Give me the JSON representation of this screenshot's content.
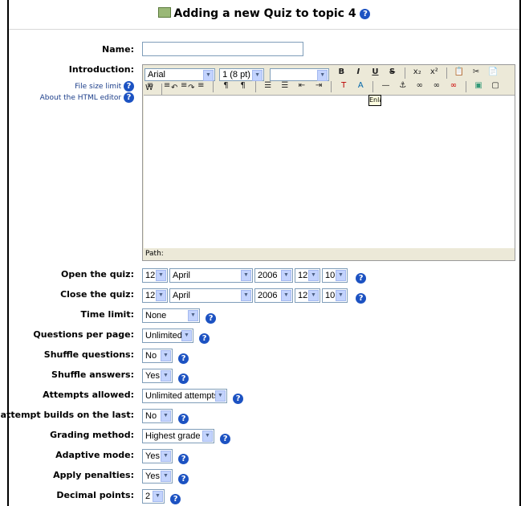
{
  "header": {
    "title": "Adding a new Quiz to topic 4",
    "help": "?"
  },
  "name": {
    "label": "Name:",
    "value": ""
  },
  "intro": {
    "label": "Introduction:",
    "file_size_link": "File size limit",
    "html_editor_link": "About the HTML editor",
    "font_family": "Arial",
    "font_size": "1 (8 pt)",
    "font_format": "",
    "toolbar_row1": [
      "B",
      "I",
      "U",
      "S",
      "x₂",
      "x²",
      "📋",
      "✂",
      "📄",
      "W",
      "↶",
      "↷"
    ],
    "toolbar_row2": [
      "≡",
      "≡",
      "≡",
      "≡",
      "¶",
      "¶",
      "☰",
      "☰",
      "⇤",
      "⇥",
      "T",
      "A",
      "—",
      "⚓",
      "∞",
      "∞",
      "∞",
      "▣",
      "▢",
      "☺",
      "◈",
      "⊞",
      "✓",
      "<>",
      "⬈"
    ],
    "path_label": "Path:",
    "tooltip": "Enla"
  },
  "open_quiz": {
    "label": "Open the quiz:",
    "day": "12",
    "month": "April",
    "year": "2006",
    "hour": "12",
    "minute": "10"
  },
  "close_quiz": {
    "label": "Close the quiz:",
    "day": "12",
    "month": "April",
    "year": "2006",
    "hour": "12",
    "minute": "10"
  },
  "time_limit": {
    "label": "Time limit:",
    "value": "None"
  },
  "questions_per_page": {
    "label": "Questions per page:",
    "value": "Unlimited"
  },
  "shuffle_questions": {
    "label": "Shuffle questions:",
    "value": "No"
  },
  "shuffle_answers": {
    "label": "Shuffle answers:",
    "value": "Yes"
  },
  "attempts_allowed": {
    "label": "Attempts allowed:",
    "value": "Unlimited attempts"
  },
  "each_attempt": {
    "label": "Each attempt builds on the last:",
    "value": "No"
  },
  "grading_method": {
    "label": "Grading method:",
    "value": "Highest grade"
  },
  "adaptive_mode": {
    "label": "Adaptive mode:",
    "value": "Yes"
  },
  "apply_penalties": {
    "label": "Apply penalties:",
    "value": "Yes"
  },
  "decimal_points": {
    "label": "Decimal points:",
    "value": "2"
  },
  "colors": {
    "link": "#1c3e8a",
    "help_icon": "#1c52c2",
    "select_arrow": "#c3d3fd"
  }
}
